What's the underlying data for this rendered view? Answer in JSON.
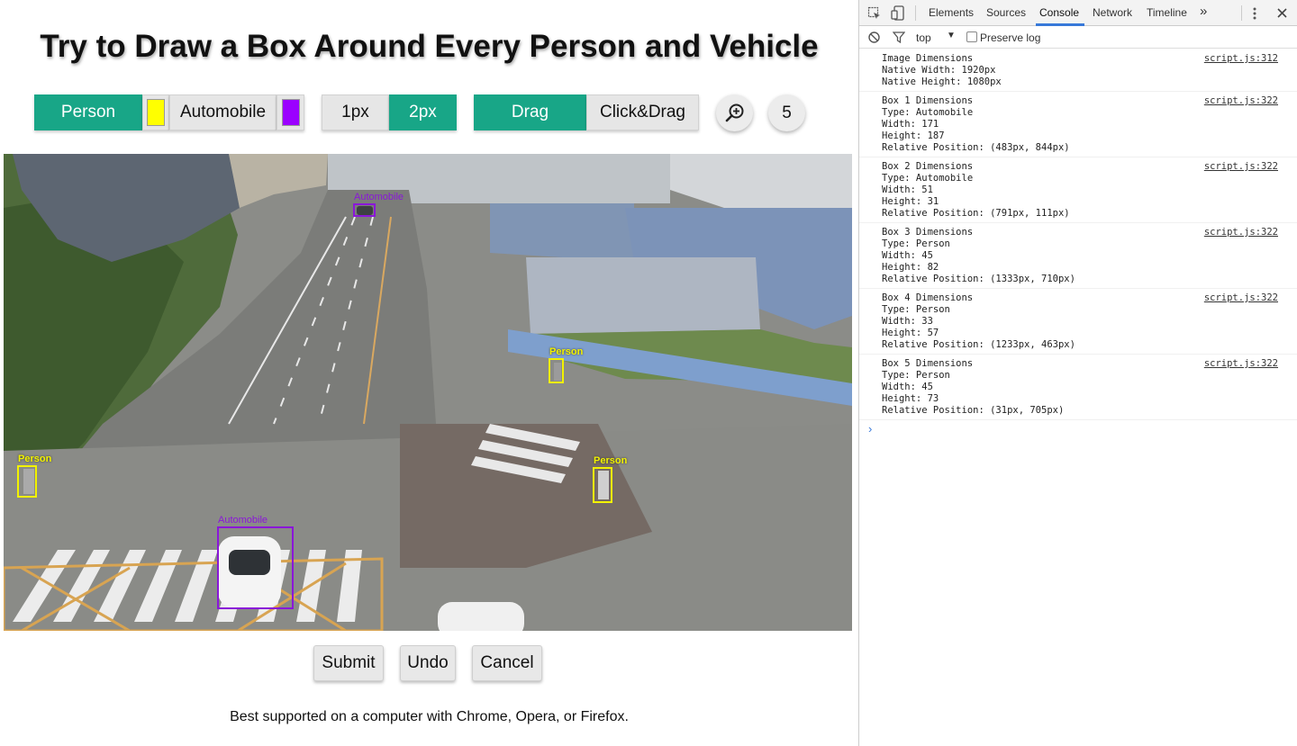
{
  "page": {
    "title": "Try to Draw a Box Around Every Person and Vehicle",
    "controls": {
      "person_label": "Person",
      "person_color": "#ffff00",
      "automobile_label": "Automobile",
      "automobile_color": "#9b00ff",
      "stroke_1": "1px",
      "stroke_2": "2px",
      "mode_drag": "Drag",
      "mode_click_drag": "Click&Drag",
      "zoom_icon": "zoom-in-icon",
      "box_count": "5"
    },
    "boxes": [
      {
        "type": "Automobile",
        "label": "Automobile"
      },
      {
        "type": "Automobile",
        "label": "Automobile"
      },
      {
        "type": "Person",
        "label": "Person"
      },
      {
        "type": "Person",
        "label": "Person"
      },
      {
        "type": "Person",
        "label": "Person"
      }
    ],
    "actions": {
      "submit": "Submit",
      "undo": "Undo",
      "cancel": "Cancel"
    },
    "footnote": "Best supported on a computer with Chrome, Opera, or Firefox."
  },
  "devtools": {
    "tabs": [
      "Elements",
      "Sources",
      "Console",
      "Network",
      "Timeline"
    ],
    "active_tab": "Console",
    "more_tabs": "»",
    "context": "top",
    "preserve_log": "Preserve log",
    "logs": [
      {
        "source": "script.js:312",
        "lines": [
          "Image Dimensions",
          "Native Width: 1920px",
          "Native Height: 1080px"
        ]
      },
      {
        "source": "script.js:322",
        "lines": [
          "Box 1 Dimensions",
          "Type: Automobile",
          "Width: 171",
          "Height: 187",
          "Relative Position: (483px, 844px)"
        ]
      },
      {
        "source": "script.js:322",
        "lines": [
          "Box 2 Dimensions",
          "Type: Automobile",
          "Width: 51",
          "Height: 31",
          "Relative Position: (791px, 111px)"
        ]
      },
      {
        "source": "script.js:322",
        "lines": [
          "Box 3 Dimensions",
          "Type: Person",
          "Width: 45",
          "Height: 82",
          "Relative Position: (1333px, 710px)"
        ]
      },
      {
        "source": "script.js:322",
        "lines": [
          "Box 4 Dimensions",
          "Type: Person",
          "Width: 33",
          "Height: 57",
          "Relative Position: (1233px, 463px)"
        ]
      },
      {
        "source": "script.js:322",
        "lines": [
          "Box 5 Dimensions",
          "Type: Person",
          "Width: 45",
          "Height: 73",
          "Relative Position: (31px, 705px)"
        ]
      }
    ],
    "prompt": "›"
  }
}
